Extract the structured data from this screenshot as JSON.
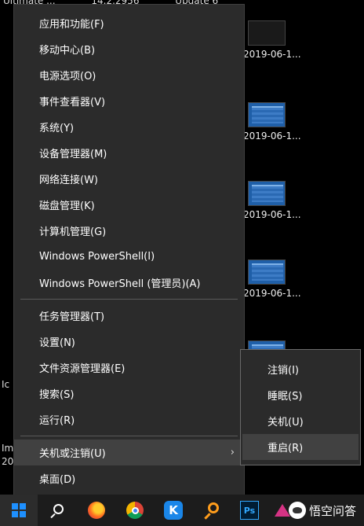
{
  "desktop": {
    "top_fragments": [
      "Ultimate ...",
      "14.2.2956",
      "Update 6"
    ],
    "files": [
      {
        "label": "2019-06-1...",
        "thumb": "dark"
      },
      {
        "label": "2019-06-1...",
        "thumb": "blue"
      },
      {
        "label": "2019-06-1...",
        "thumb": "blue"
      },
      {
        "label": "2019-06-1...",
        "thumb": "blue"
      },
      {
        "label": "",
        "thumb": "blue"
      }
    ],
    "left_fragments": [
      "Ic",
      "Im",
      "20"
    ]
  },
  "context_menu": {
    "items": [
      "应用和功能(F)",
      "移动中心(B)",
      "电源选项(O)",
      "事件查看器(V)",
      "系统(Y)",
      "设备管理器(M)",
      "网络连接(W)",
      "磁盘管理(K)",
      "计算机管理(G)",
      "Windows PowerShell(I)",
      "Windows PowerShell (管理员)(A)",
      "任务管理器(T)",
      "设置(N)",
      "文件资源管理器(E)",
      "搜索(S)",
      "运行(R)",
      "关机或注销(U)",
      "桌面(D)"
    ],
    "highlighted": "关机或注销(U)"
  },
  "submenu": {
    "items": [
      "注销(I)",
      "睡眠(S)",
      "关机(U)",
      "重启(R)"
    ],
    "highlighted": "重启(R)"
  },
  "taskbar": {
    "icons": [
      "windows-start-icon",
      "search-icon",
      "firefox-icon",
      "chrome-icon",
      "kugou-icon",
      "search-app-icon",
      "photoshop-icon",
      "triangle-app-icon"
    ],
    "kugou_letter": "K",
    "photoshop_text": "Ps"
  },
  "watermark": {
    "text": "悟空问答"
  },
  "colors": {
    "menu_bg": "#2b2b2b",
    "highlight_bg": "#414141",
    "taskbar_bg": "#1c1c1c",
    "accent": "#1e90ff"
  }
}
